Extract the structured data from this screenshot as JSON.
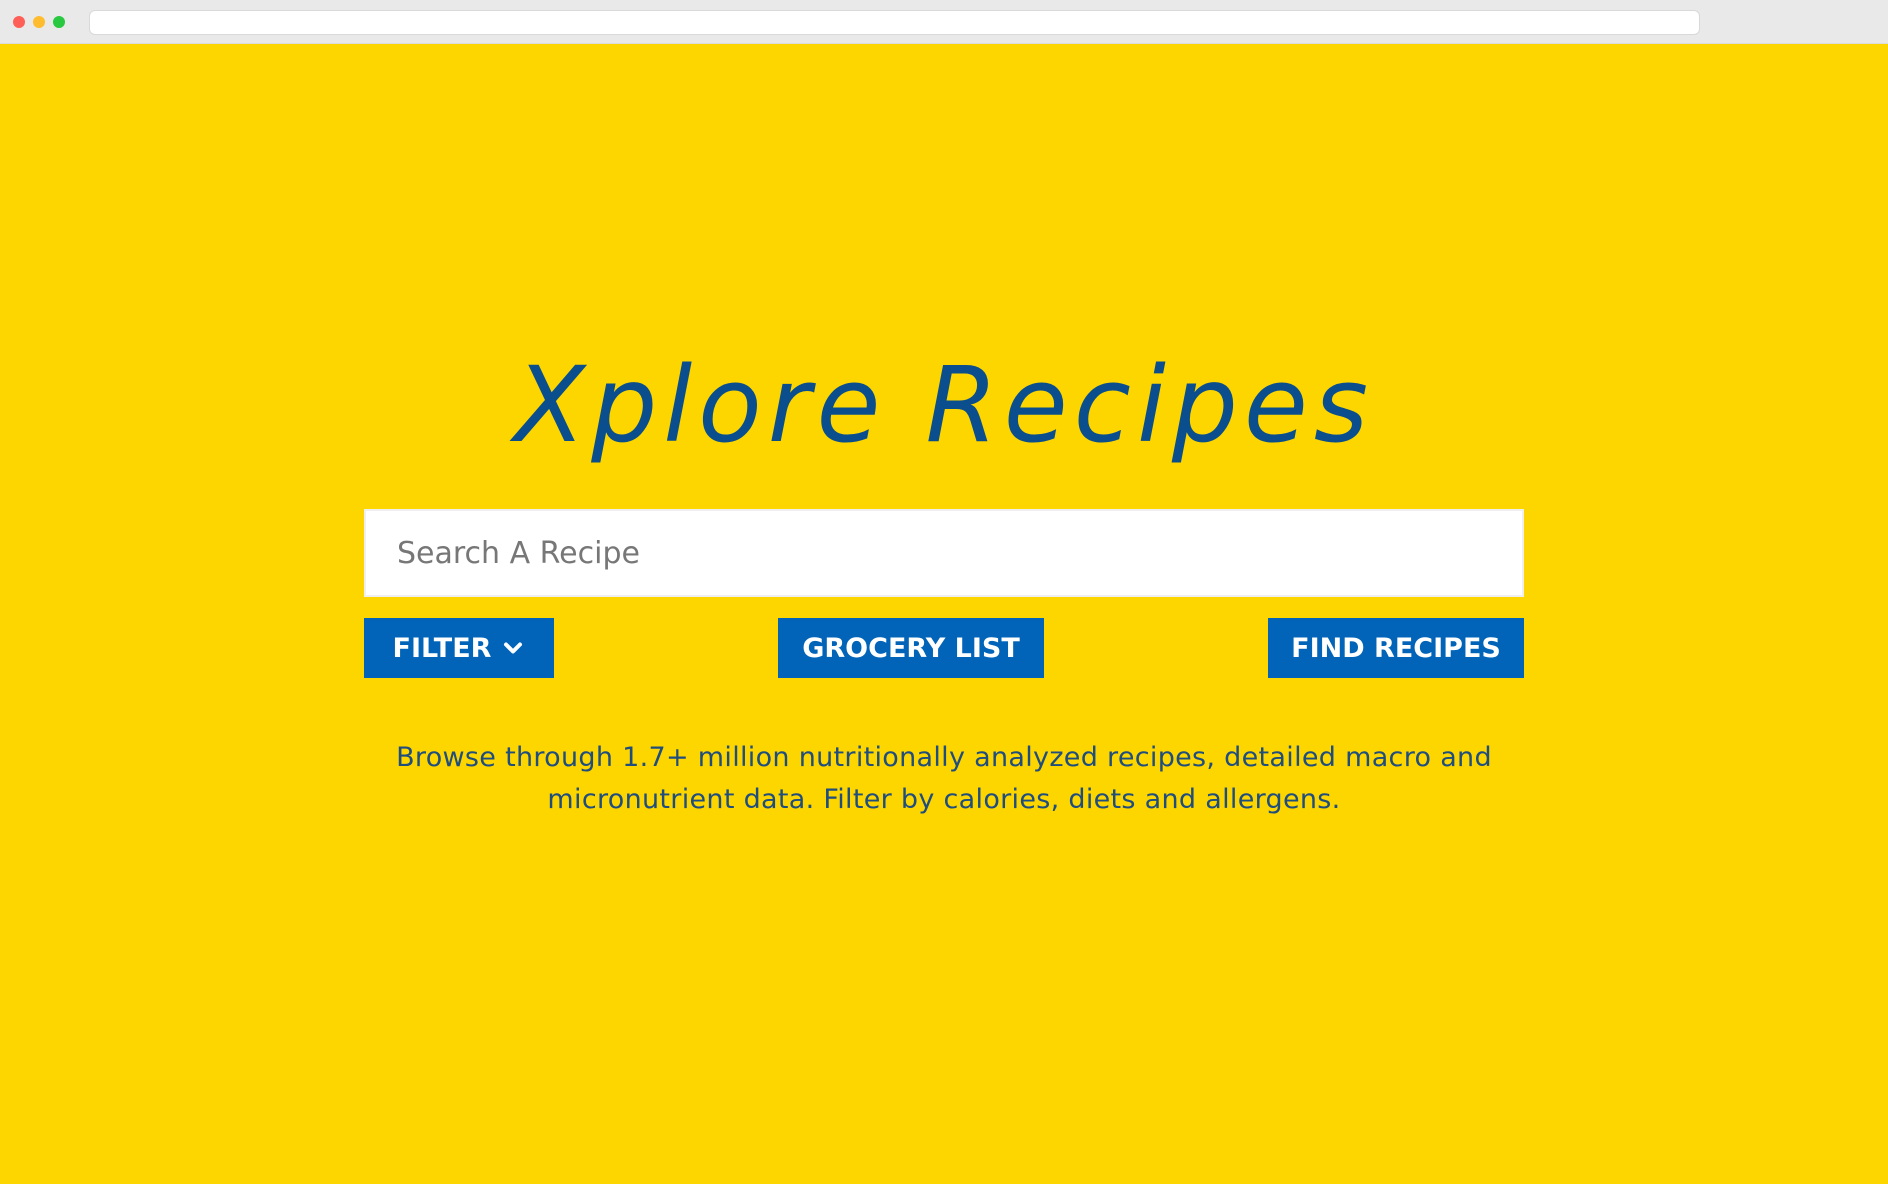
{
  "browser": {
    "address": ""
  },
  "colors": {
    "background": "#FDD600",
    "accent": "#0264B8",
    "title": "#0A4E8D",
    "description": "#1F4D7E",
    "close": "#FF5F57",
    "minimize": "#FEBC2E",
    "maximize": "#28C840"
  },
  "header": {
    "title": "Xplore Recipes"
  },
  "search": {
    "placeholder": "Search A Recipe",
    "value": ""
  },
  "actions": {
    "filter_label": "FILTER",
    "filter_icon": "chevron-down-icon",
    "grocery_label": "GROCERY LIST",
    "find_label": "FIND RECIPES"
  },
  "main": {
    "description": "Browse through 1.7+ million nutritionally analyzed recipes, detailed macro and micronutrient data. Filter by calories, diets and allergens."
  }
}
